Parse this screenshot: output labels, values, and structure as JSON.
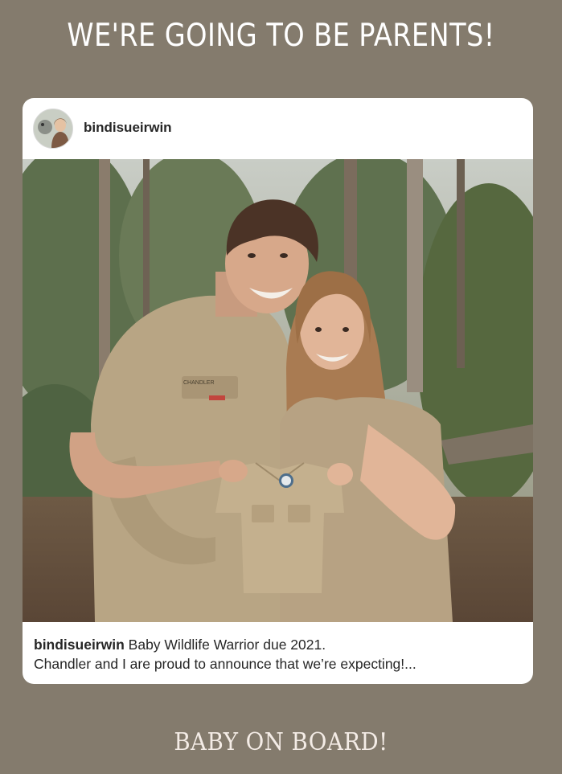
{
  "story": {
    "title": "WE'RE GOING TO BE PARENTS!",
    "bottom_text": "BABY ON BOARD!",
    "background_color": "#847b6d"
  },
  "post": {
    "username": "bindisueirwin",
    "caption_user": "bindisueirwin",
    "caption_text_line1": " Baby Wildlife Warrior due 2021.",
    "caption_text_line2": "Chandler and I are proud to announce that we’re expecting!...",
    "shirt_tag": "CHANDLER",
    "avatar_icon": "profile-photo",
    "photo_description_icon": "couple-photo"
  }
}
